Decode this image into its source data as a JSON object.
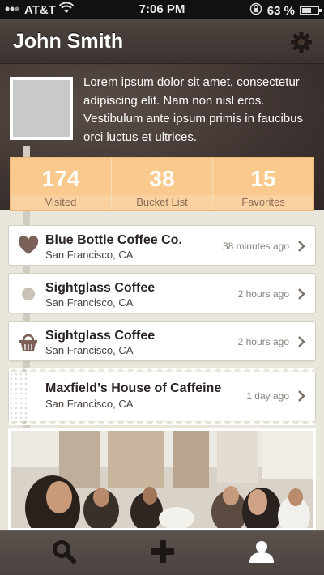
{
  "status_bar": {
    "carrier": "AT&T",
    "time": "7:06 PM",
    "battery": "63 %",
    "battery_level": 0.63
  },
  "header": {
    "title": "John Smith"
  },
  "profile": {
    "bio": "Lorem ipsum dolor sit amet, consectetur adipiscing elit. Nam non nisl eros. Vestibulum ante ipsum primis in faucibus orci luctus et ultrices."
  },
  "stats": [
    {
      "value": "174",
      "label": "Visited"
    },
    {
      "value": "38",
      "label": "Bucket List"
    },
    {
      "value": "15",
      "label": "Favorites"
    }
  ],
  "places": [
    {
      "name": "Blue Bottle Coffee Co.",
      "location": "San Francisco, CA",
      "time": "38 minutes ago",
      "icon": "heart-icon"
    },
    {
      "name": "Sightglass Coffee",
      "location": "San Francisco, CA",
      "time": "2 hours ago",
      "icon": "dot-icon"
    },
    {
      "name": "Sightglass Coffee",
      "location": "San Francisco, CA",
      "time": "2 hours ago",
      "icon": "basket-icon"
    },
    {
      "name": "Maxfield’s House of Caffeine",
      "location": "San Francisco, CA",
      "time": "1 day ago",
      "icon": "ticket-icon"
    }
  ],
  "tabbar": {
    "tabs": [
      {
        "icon": "search-icon"
      },
      {
        "icon": "plus-icon"
      },
      {
        "icon": "profile-icon"
      }
    ]
  },
  "colors": {
    "header_bg": "#3b3330",
    "stats_bg": "#f9c98e",
    "content_bg": "#e9e6dc",
    "icon_brown": "#7b6058"
  }
}
